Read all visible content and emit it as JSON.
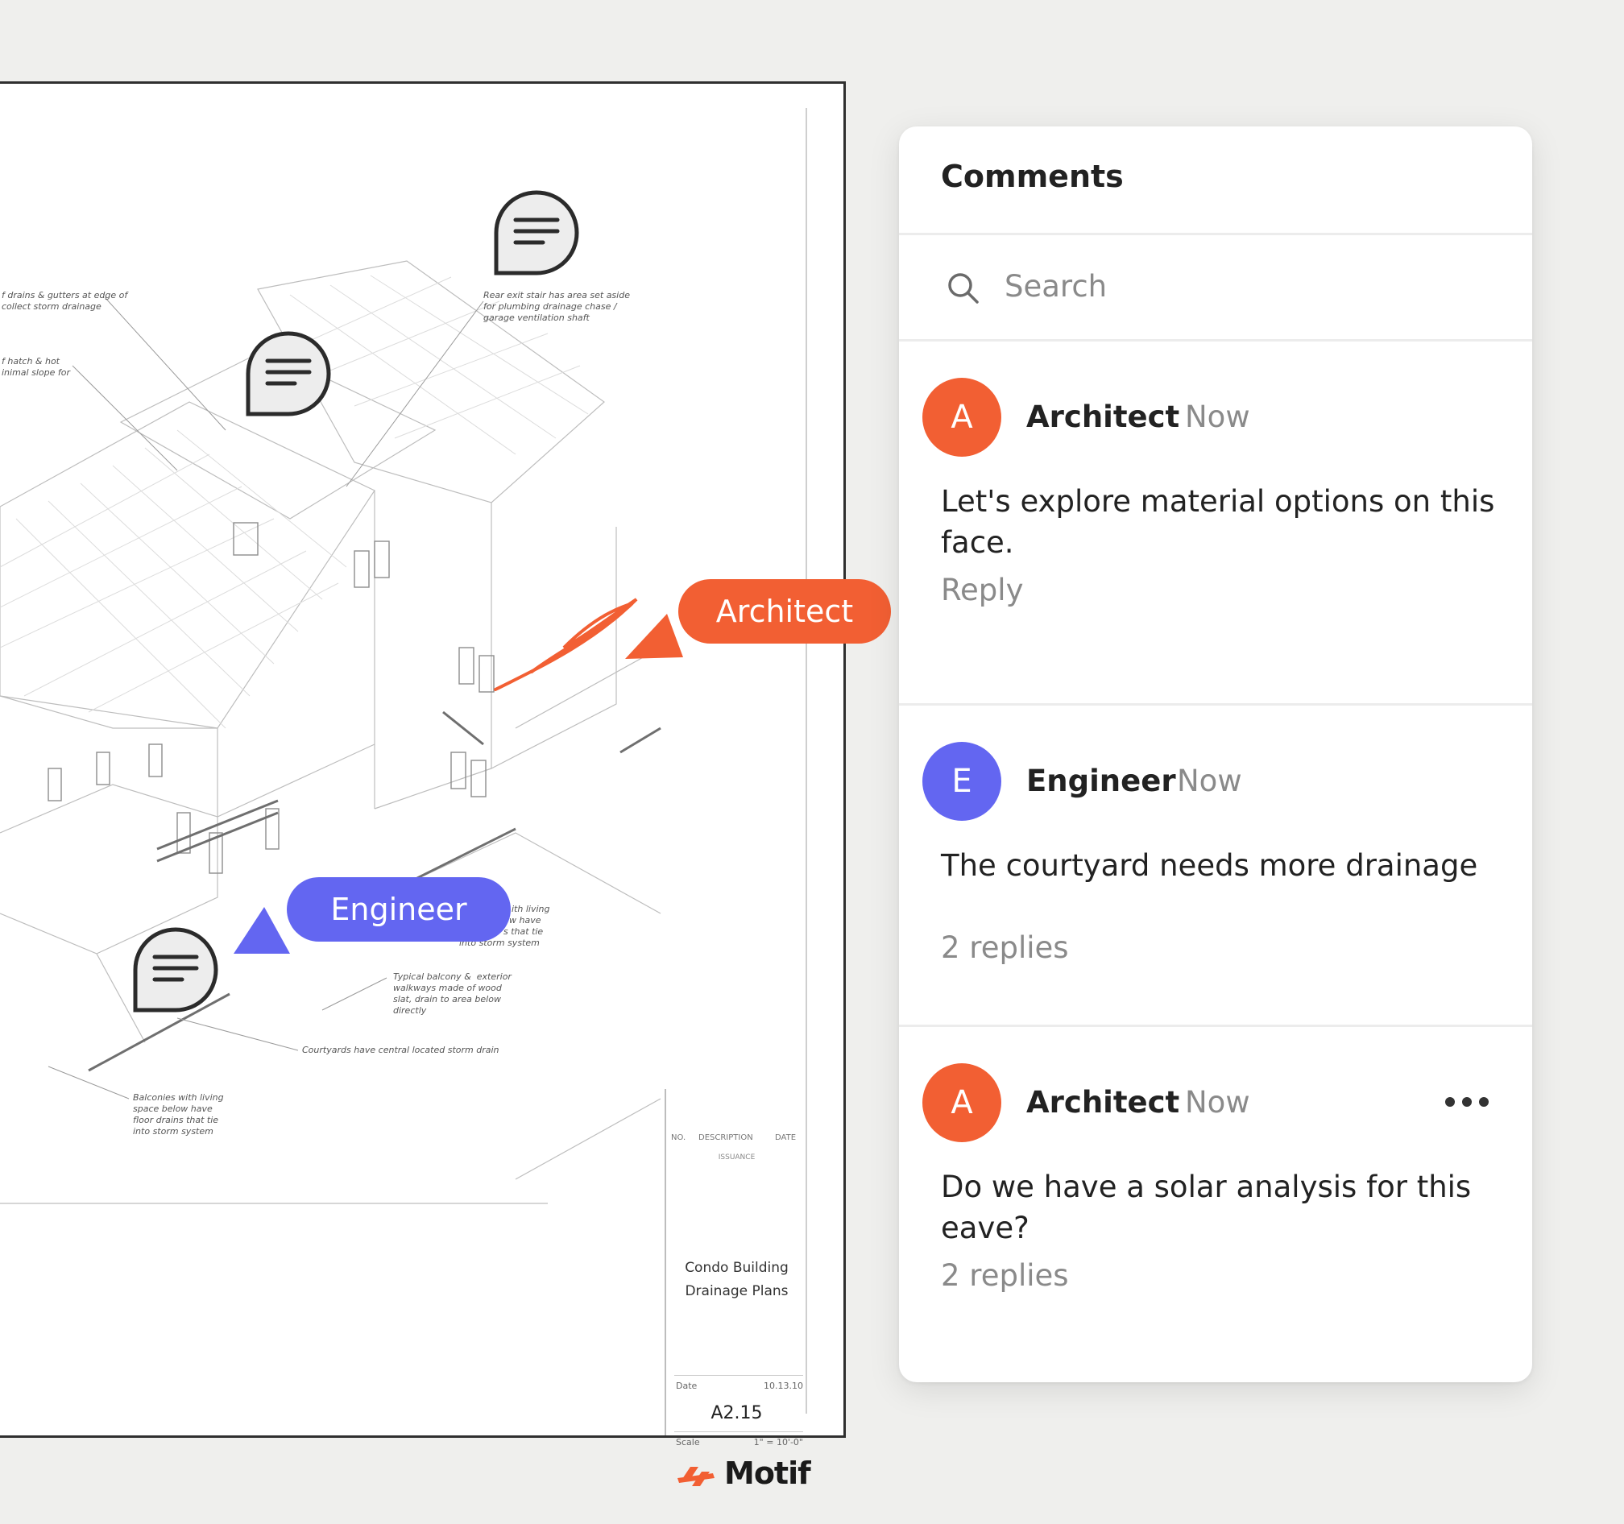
{
  "drawing": {
    "notes": [
      [
        "f drains & gutters at edge of",
        "collect storm drainage"
      ],
      [
        "f hatch & hot",
        "inimal slope for"
      ],
      [
        "Rear exit stair has area set aside",
        "for plumbing drainage chase /",
        "garage ventilation shaft"
      ],
      [
        "Typical balcony &  exterior",
        "walkways made of wood",
        "slat, drain to area below",
        "directly"
      ],
      [
        "Courtyards have central located storm drain"
      ],
      [
        "Balconies with living",
        "space below have",
        "floor drains that tie",
        "into storm system"
      ],
      [
        "ith living",
        "w have",
        "s that tie",
        "into storm system"
      ]
    ],
    "title_block": {
      "col_no": "NO.",
      "col_description": "DESCRIPTION",
      "col_date": "DATE",
      "issuance": "ISSUANCE",
      "project_line1": "Condo Building",
      "project_line2": "Drainage Plans",
      "date_label": "Date",
      "date_value": "10.13.10",
      "sheet_number": "A2.15",
      "scale_label": "Scale",
      "scale_value": "1\" = 10'-0\"",
      "logo_text": "Motif"
    },
    "tags": {
      "architect": "Architect",
      "engineer": "Engineer"
    }
  },
  "comments_panel": {
    "title": "Comments",
    "search_placeholder": "Search",
    "comments": [
      {
        "avatar": "A",
        "author": "Architect",
        "time": "Now",
        "text": "Let's explore material options on this face.",
        "footer": "Reply"
      },
      {
        "avatar": "E",
        "author": "Engineer",
        "time": "Now",
        "text": "The courtyard needs more drainage",
        "footer": "2 replies"
      },
      {
        "avatar": "A",
        "author": "Architect",
        "time": "Now",
        "text": "Do we have a solar analysis for this eave?",
        "footer": "2 replies"
      }
    ]
  },
  "colors": {
    "architect": "#f25f33",
    "engineer": "#6366f1",
    "background": "#efefed"
  }
}
